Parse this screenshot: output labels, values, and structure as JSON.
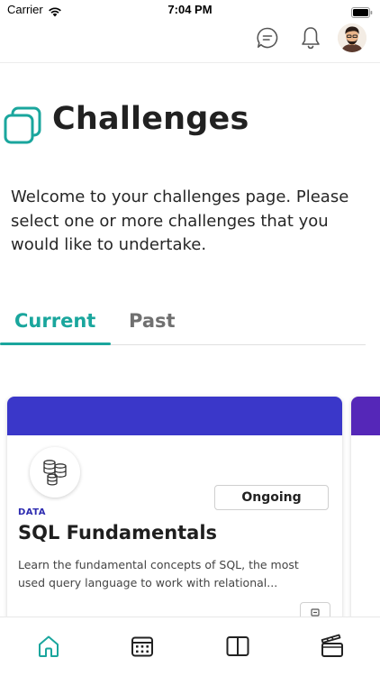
{
  "status_bar": {
    "carrier": "Carrier",
    "time": "7:04 PM"
  },
  "top_bar": {
    "icons": [
      "chat-bubble-icon",
      "bell-icon"
    ],
    "avatar": "user-avatar"
  },
  "header": {
    "title": "Challenges",
    "intro": "Welcome to your challenges page. Please select one or more challenges that you would like to undertake."
  },
  "tabs": [
    {
      "label": "Current",
      "active": true
    },
    {
      "label": "Past",
      "active": false
    }
  ],
  "challenge_card": {
    "status": "Ongoing",
    "category": "DATA",
    "title": "SQL Fundamentals",
    "description": "Learn the fundamental concepts of SQL, the most used query language to work with relational...",
    "banner_color": "#3a37c9",
    "icon": "database-icon"
  },
  "bottom_nav": [
    {
      "name": "home",
      "icon": "home-icon",
      "active": true
    },
    {
      "name": "calendar",
      "icon": "calendar-icon",
      "active": false
    },
    {
      "name": "book",
      "icon": "book-icon",
      "active": false
    },
    {
      "name": "media",
      "icon": "clapperboard-icon",
      "active": false
    }
  ],
  "colors": {
    "accent": "#1aa69d",
    "card_banner": "#3a37c9",
    "category": "#2d2bb0"
  }
}
